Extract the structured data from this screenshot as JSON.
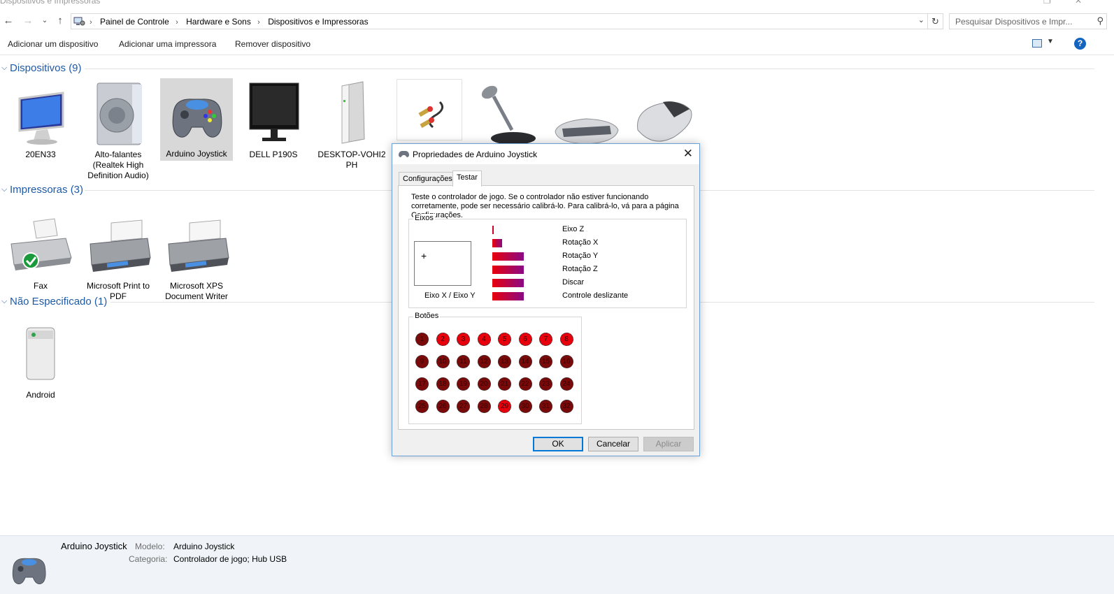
{
  "window": {
    "title": "Dispositivos e Impressoras"
  },
  "address": {
    "crumbs": [
      "Painel de Controle",
      "Hardware e Sons",
      "Dispositivos e Impressoras"
    ],
    "search_placeholder": "Pesquisar Dispositivos e Impr..."
  },
  "commands": {
    "add_device": "Adicionar um dispositivo",
    "add_printer": "Adicionar uma impressora",
    "remove_device": "Remover dispositivo",
    "help": "?"
  },
  "groups": {
    "devices": {
      "title": "Dispositivos (9)",
      "items": [
        "20EN33",
        "Alto-falantes (Realtek High Definition Audio)",
        "Arduino Joystick",
        "DELL P190S",
        "DESKTOP-VOHI2 PH"
      ]
    },
    "printers": {
      "title": "Impressoras (3)",
      "items": [
        "Fax",
        "Microsoft Print to PDF",
        "Microsoft XPS Document Writer"
      ]
    },
    "unspecified": {
      "title": "Não Especificado (1)",
      "items": [
        "Android"
      ]
    }
  },
  "details": {
    "name": "Arduino Joystick",
    "model_key": "Modelo:",
    "model_val": "Arduino Joystick",
    "category_key": "Categoria:",
    "category_val": "Controlador de jogo; Hub USB"
  },
  "dialog": {
    "title": "Propriedades de Arduino Joystick",
    "tabs": [
      "Configurações",
      "Testar"
    ],
    "active_tab": "Testar",
    "description": "Teste o controlador de jogo. Se o controlador não estiver funcionando corretamente, pode ser necessário calibrá-lo. Para calibrá-lo, vá para a página Configurações.",
    "axes_legend": "Eixos",
    "xy_label": "Eixo X / Eixo Y",
    "axes": [
      {
        "name": "Eixo Z",
        "level": 0.04
      },
      {
        "name": "Rotação X",
        "level": 0.3
      },
      {
        "name": "Rotação Y",
        "level": 1.0
      },
      {
        "name": "Rotação Z",
        "level": 1.0
      },
      {
        "name": "Discar",
        "level": 1.0
      },
      {
        "name": "Controle deslizante",
        "level": 1.0
      }
    ],
    "buttons_legend": "Botões",
    "buttons": [
      {
        "n": "1",
        "on": false
      },
      {
        "n": "2",
        "on": true
      },
      {
        "n": "3",
        "on": true
      },
      {
        "n": "4",
        "on": true
      },
      {
        "n": "5",
        "on": true
      },
      {
        "n": "6",
        "on": true
      },
      {
        "n": "7",
        "on": true
      },
      {
        "n": "8",
        "on": true
      },
      {
        "n": "9",
        "on": false
      },
      {
        "n": "10",
        "on": false
      },
      {
        "n": "11",
        "on": false
      },
      {
        "n": "12",
        "on": false
      },
      {
        "n": "13",
        "on": false
      },
      {
        "n": "14",
        "on": false
      },
      {
        "n": "15",
        "on": false
      },
      {
        "n": "16",
        "on": false
      },
      {
        "n": "17",
        "on": false
      },
      {
        "n": "18",
        "on": false
      },
      {
        "n": "19",
        "on": false
      },
      {
        "n": "20",
        "on": false
      },
      {
        "n": "21",
        "on": false
      },
      {
        "n": "22",
        "on": false
      },
      {
        "n": "23",
        "on": false
      },
      {
        "n": "24",
        "on": false
      },
      {
        "n": "25",
        "on": false
      },
      {
        "n": "26",
        "on": false
      },
      {
        "n": "27",
        "on": false
      },
      {
        "n": "28",
        "on": false
      },
      {
        "n": "29",
        "on": true
      },
      {
        "n": "30",
        "on": false
      },
      {
        "n": "31",
        "on": false
      },
      {
        "n": "32",
        "on": false
      }
    ],
    "ok": "OK",
    "cancel": "Cancelar",
    "apply": "Aplicar"
  },
  "colors": {
    "group_header": "#1e5aa8",
    "button_on": "#e8000c",
    "button_off": "#7a0a0a"
  }
}
